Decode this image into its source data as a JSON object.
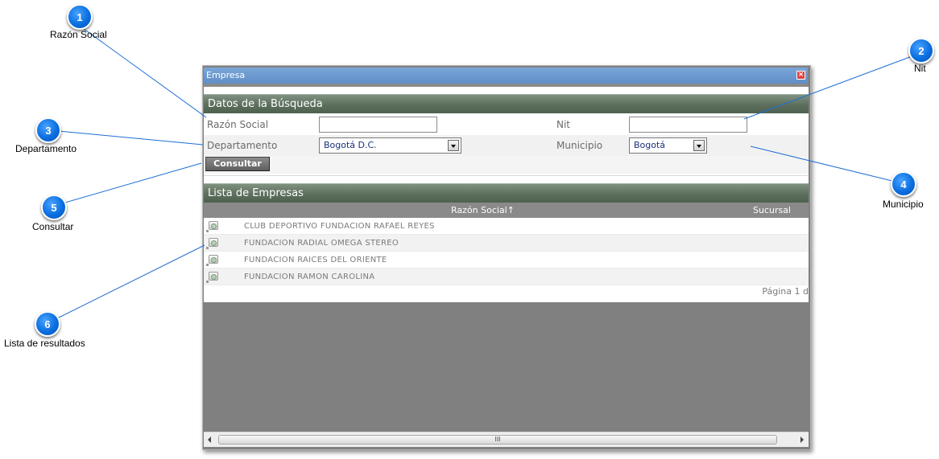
{
  "window": {
    "title": "Empresa",
    "close_symbol": "×"
  },
  "search": {
    "header": "Datos de la Búsqueda",
    "razon_social_label": "Razón Social",
    "razon_social_value": "",
    "nit_label": "Nit",
    "nit_value": "",
    "departamento_label": "Departamento",
    "departamento_value": "Bogotá D.C.",
    "municipio_label": "Municipio",
    "municipio_value": "Bogotá",
    "consultar_label": "Consultar"
  },
  "results": {
    "header": "Lista de Empresas",
    "columns": [
      "Razón Social↑",
      "Sucursal"
    ],
    "rows": [
      "CLUB DEPORTIVO FUNDACION RAFAEL REYES",
      "FUNDACION RADIAL OMEGA STEREO",
      "FUNDACION RAICES DEL ORIENTE",
      "FUNDACION RAMON CAROLINA"
    ],
    "row_icon": "select-row-icon",
    "pager_text": "Página 1 d"
  },
  "scrollbar": {
    "grip": "III"
  },
  "callouts": [
    {
      "number": "1",
      "label": "Razón Social"
    },
    {
      "number": "2",
      "label": "Nit"
    },
    {
      "number": "3",
      "label": "Departamento"
    },
    {
      "number": "4",
      "label": "Municipio"
    },
    {
      "number": "5",
      "label": "Consultar"
    },
    {
      "number": "6",
      "label": "Lista de resultados"
    }
  ],
  "colors": {
    "callout_blue": "#0a6fe0",
    "title_bar": "#6b9bd2",
    "section_header": "#5c6f5d",
    "grid_header": "#8a8a8a",
    "window_body": "#808080"
  }
}
